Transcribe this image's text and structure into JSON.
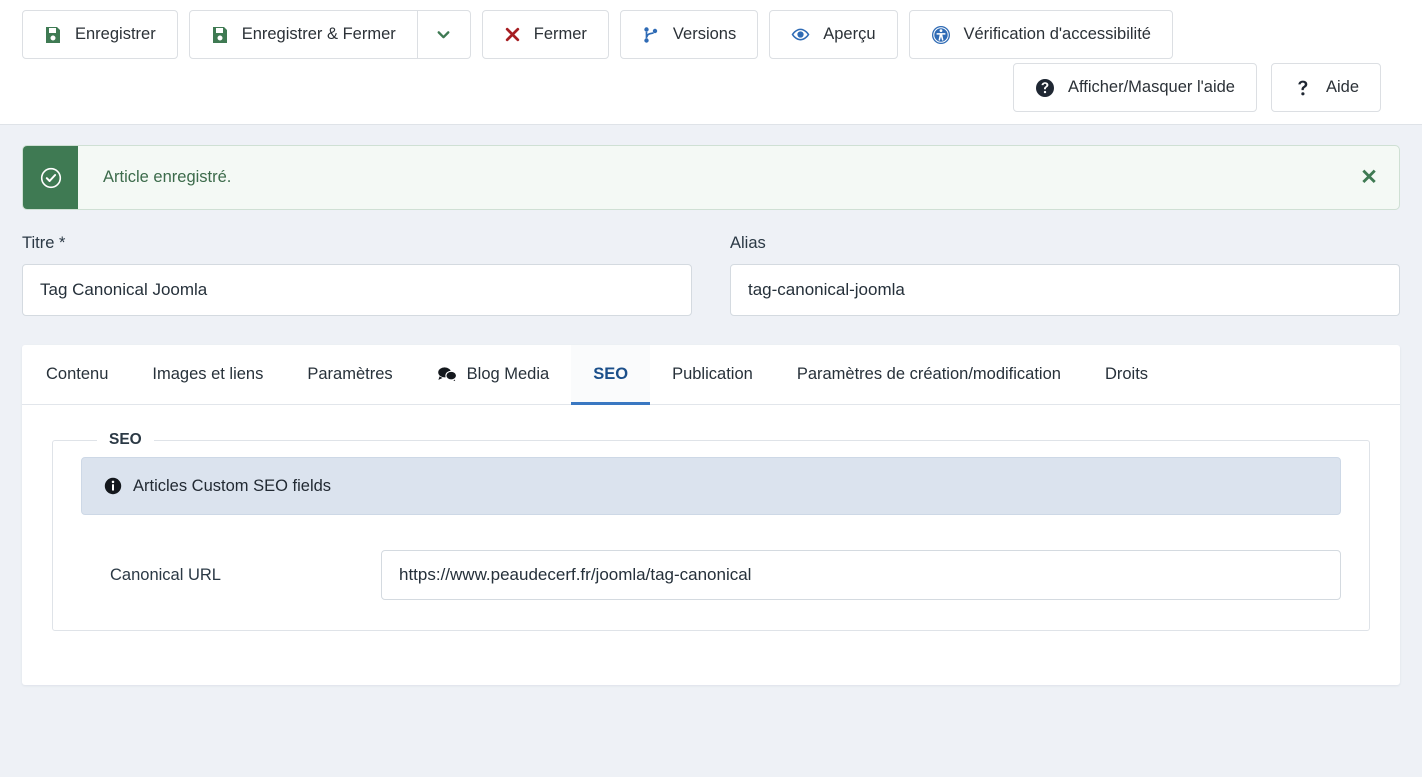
{
  "toolbar": {
    "row1": [
      {
        "label": "Enregistrer",
        "icon": "save-icon",
        "name": "save-button",
        "has_caret": false
      },
      {
        "label": "Enregistrer & Fermer",
        "icon": "save-icon",
        "name": "save-and-close-button",
        "has_caret": true
      },
      {
        "label": "Fermer",
        "icon": "close-x-icon",
        "name": "close-button",
        "has_caret": false
      },
      {
        "label": "Versions",
        "icon": "code-branch-icon",
        "name": "versions-button",
        "has_caret": false
      },
      {
        "label": "Aperçu",
        "icon": "eye-icon",
        "name": "preview-button",
        "has_caret": false
      },
      {
        "label": "Vérification d'accessibilité",
        "icon": "universal-access-icon",
        "name": "accessibility-check-button",
        "has_caret": false
      }
    ],
    "row2": [
      {
        "label": "Afficher/Masquer l'aide",
        "icon": "question-circle-icon",
        "name": "toggle-help-button"
      },
      {
        "label": "Aide",
        "icon": "question-mark-icon",
        "name": "help-button"
      }
    ],
    "caret_icon": "chevron-down-icon"
  },
  "alert": {
    "message": "Article enregistré.",
    "status_icon": "check-circle-icon",
    "close_label": "✕",
    "accent_color": "#3f7a53",
    "background_color": "#f4f9f5"
  },
  "form": {
    "title": {
      "label": "Titre *",
      "value": "Tag Canonical Joomla",
      "placeholder": ""
    },
    "alias": {
      "label": "Alias",
      "value": "tag-canonical-joomla",
      "placeholder": ""
    }
  },
  "tabs": [
    {
      "label": "Contenu",
      "name": "tab-contenu",
      "icon": null,
      "active": false
    },
    {
      "label": "Images et liens",
      "name": "tab-images-et-liens",
      "icon": null,
      "active": false
    },
    {
      "label": "Paramètres",
      "name": "tab-parametres",
      "icon": null,
      "active": false
    },
    {
      "label": "Blog Media",
      "name": "tab-blog-media",
      "icon": "comments-icon",
      "active": false
    },
    {
      "label": "SEO",
      "name": "tab-seo",
      "icon": null,
      "active": true
    },
    {
      "label": "Publication",
      "name": "tab-publication",
      "icon": null,
      "active": false
    },
    {
      "label": "Paramètres de création/modification",
      "name": "tab-parametres-creation-modification",
      "icon": null,
      "active": false
    },
    {
      "label": "Droits",
      "name": "tab-droits",
      "icon": null,
      "active": false
    }
  ],
  "seo_panel": {
    "legend": "SEO",
    "info": {
      "text": "Articles Custom SEO fields",
      "icon": "info-circle-icon",
      "background_color": "#dbe3ee"
    },
    "canonical": {
      "label": "Canonical URL",
      "value": "https://www.peaudecerf.fr/joomla/tag-canonical",
      "placeholder": ""
    }
  },
  "theme": {
    "page_background": "#eef1f6",
    "panel_background": "#ffffff",
    "accent_blue": "#3a78c2",
    "save_green": "#3f7a53",
    "danger_red": "#a61e22"
  }
}
